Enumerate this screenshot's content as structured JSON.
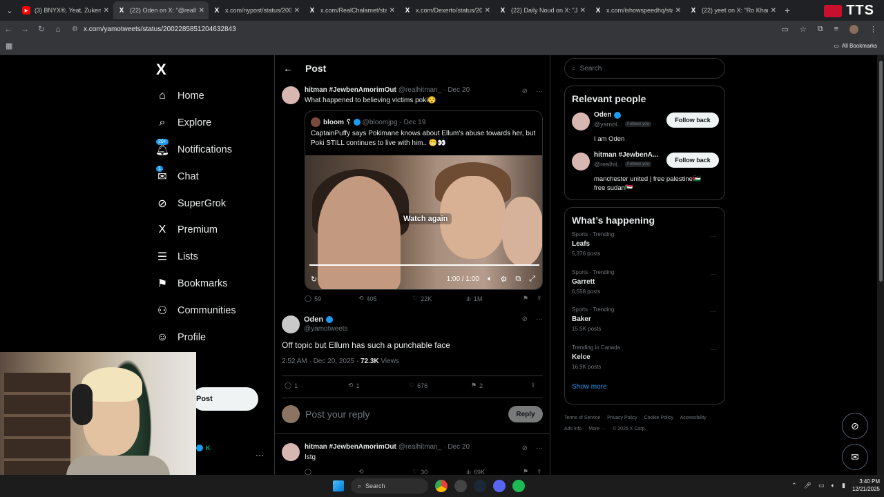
{
  "browser": {
    "tabs": [
      {
        "title": "(3) BNYX®, Yeat, Zukenee",
        "icon": "youtube-icon"
      },
      {
        "title": "(22) Oden on X: \"@realhi",
        "icon": "x-icon",
        "active": true
      },
      {
        "title": "x.com/nypost/status/200",
        "icon": "x-icon"
      },
      {
        "title": "x.com/RealChalamet/stat",
        "icon": "x-icon"
      },
      {
        "title": "x.com/Dexerto/status/20",
        "icon": "x-icon"
      },
      {
        "title": "(22) Daily Noud on X: \"Je",
        "icon": "x-icon"
      },
      {
        "title": "x.com/ishowspeedhq/sta",
        "icon": "x-icon"
      },
      {
        "title": "(22) yeet on X: \"Ro Khann",
        "icon": "x-icon"
      }
    ],
    "new_tab": "+",
    "overlay_label": "TTS",
    "url": "x.com/yamotweets/status/2002285851204632843",
    "all_bookmarks": "All Bookmarks"
  },
  "nav": {
    "logo": "X",
    "items": [
      {
        "label": "Home",
        "icon": "home-icon",
        "glyph": "⌂"
      },
      {
        "label": "Explore",
        "icon": "search-icon",
        "glyph": "⌕"
      },
      {
        "label": "Notifications",
        "icon": "bell-icon",
        "glyph": "🔔︎",
        "badge": "20+"
      },
      {
        "label": "Chat",
        "icon": "mail-icon",
        "glyph": "✉",
        "badge": "1"
      },
      {
        "label": "SuperGrok",
        "icon": "grok-icon",
        "glyph": "⊘"
      },
      {
        "label": "Premium",
        "icon": "x-premium-icon",
        "glyph": "X"
      },
      {
        "label": "Lists",
        "icon": "list-icon",
        "glyph": "☰"
      },
      {
        "label": "Bookmarks",
        "icon": "bookmark-icon",
        "glyph": "⚑"
      },
      {
        "label": "Communities",
        "icon": "people-icon",
        "glyph": "⚇"
      },
      {
        "label": "Profile",
        "icon": "person-icon",
        "glyph": "☺"
      },
      {
        "label": "e",
        "icon": "more-icon",
        "glyph": ""
      }
    ],
    "post_button": "Post",
    "more": "···"
  },
  "header": {
    "back": "←",
    "title": "Post"
  },
  "tweet1": {
    "name": "hitman #JewbenAmorimOut",
    "handle": "@realhitman_",
    "date": "· Dec 20",
    "text": "What happened to believing victims poki😯",
    "quote": {
      "name": "bloom ␦",
      "handle": "@bloomjpg",
      "date": "· Dec 19",
      "text": "CaptainPuffy says Pokimane knows about Ellum's abuse towards her, but Poki STILL continues to live with him.. 😬👀",
      "video": {
        "overlay": "Watch again",
        "time": "1:00 / 1:00",
        "progress": 1.0
      }
    },
    "replies": "59",
    "reposts": "405",
    "likes": "22K",
    "views": "1M"
  },
  "tweet2": {
    "name": "Oden",
    "handle": "@yamotweets",
    "text": "Off topic but Ellum has such a punchable face",
    "time": "2:52 AM · Dec 20, 2025 ·",
    "views_count": "72.3K",
    "views_label": "Views",
    "replies": "1",
    "reposts": "1",
    "likes": "676",
    "bookmarks": "2"
  },
  "reply_box": {
    "placeholder": "Post your reply",
    "button": "Reply"
  },
  "tweet3": {
    "name": "hitman #JewbenAmorimOut",
    "handle": "@realhitman_",
    "date": "· Dec 20",
    "text": "Istg",
    "likes": "30",
    "views": "69K"
  },
  "search": {
    "placeholder": "Search"
  },
  "relevant": {
    "title": "Relevant people",
    "people": [
      {
        "name": "Oden",
        "handle": "@yamot...",
        "follows_you": "Follows you",
        "bio": "I am Oden",
        "button": "Follow back"
      },
      {
        "name": "hitman #JewbenA...",
        "handle": "@realhit...",
        "follows_you": "Follows you",
        "bio": "manchester united | free palestine🇵🇸\nfree sudan🇸🇩",
        "button": "Follow back"
      }
    ]
  },
  "happening": {
    "title": "What’s happening",
    "trends": [
      {
        "category": "Sports · Trending",
        "name": "Leafs",
        "count": "5,376 posts"
      },
      {
        "category": "Sports · Trending",
        "name": "Garrett",
        "count": "6,558 posts"
      },
      {
        "category": "Sports · Trending",
        "name": "Baker",
        "count": "15.5K posts"
      },
      {
        "category": "Trending in Canada",
        "name": "Kelce",
        "count": "16.9K posts"
      }
    ],
    "show_more": "Show more"
  },
  "footer": {
    "links": [
      "Terms of Service",
      "Privacy Policy",
      "Cookie Policy",
      "Accessibility",
      "Ads info",
      "More ···",
      "© 2025 X Corp."
    ]
  },
  "taskbar": {
    "search": "Search",
    "time": "3:40 PM",
    "date": "12/21/2025"
  },
  "colors": {
    "accent": "#1d9bf0",
    "background": "#000000",
    "text": "#e7e9ea",
    "muted": "#71767b"
  }
}
